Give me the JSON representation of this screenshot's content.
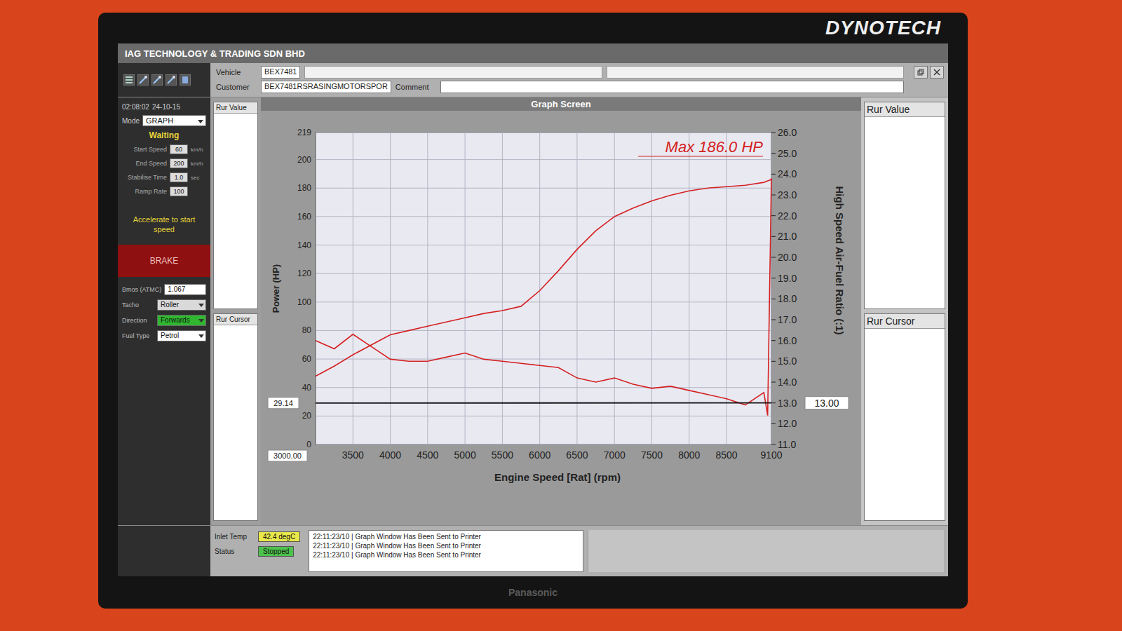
{
  "monitor": {
    "logo": "DYNOTECH",
    "brand": "Panasonic"
  },
  "window": {
    "title": "IAG TECHNOLOGY & TRADING SDN BHD"
  },
  "fields": [
    {
      "label": "Vehicle",
      "value": "BEX7481"
    },
    {
      "label": "Customer",
      "value": "BEX7481RSRASINGMOTORSPOR"
    },
    {
      "label": "Comment",
      "value": ""
    }
  ],
  "control": {
    "time": "02:08:02",
    "date": "24-10-15",
    "mode_label": "Mode",
    "mode": "GRAPH",
    "state": "Waiting",
    "settings": [
      {
        "label": "Start Speed",
        "value": "60",
        "unit": "km/h"
      },
      {
        "label": "End Speed",
        "value": "200",
        "unit": "km/h"
      },
      {
        "label": "Stabilise Time",
        "value": "1.0",
        "unit": "sec"
      },
      {
        "label": "Ramp Rate",
        "value": "100"
      }
    ],
    "prompt": "Accelerate to start speed",
    "brake": "BRAKE",
    "options": [
      {
        "label": "Bmos (ATMC)",
        "value": "1.067",
        "kind": "field",
        "color": "#ffffff"
      },
      {
        "label": "Tacho",
        "value": "Roller",
        "kind": "dropdown",
        "color": "#d9d9d9"
      },
      {
        "label": "Direction",
        "value": "Forwards",
        "kind": "dropdown",
        "color": "#2fb82f"
      },
      {
        "label": "Fuel Type",
        "value": "Petrol",
        "kind": "dropdown",
        "color": "#ffffff"
      }
    ]
  },
  "left_panels": [
    {
      "title": "Rur Value"
    },
    {
      "title": "Rur Cursor"
    }
  ],
  "right_panels": [
    {
      "title": "Rur Value"
    },
    {
      "title": "Rur Cursor"
    }
  ],
  "graph": {
    "header": "Graph Screen",
    "max_label": "Max 186.0 HP",
    "y_left": {
      "title": "Power (HP)",
      "ticks": [
        "0",
        "20",
        "40",
        "60",
        "80",
        "100",
        "120",
        "140",
        "160",
        "180",
        "200",
        "219"
      ]
    },
    "y_right": {
      "title": "High Speed Air-Fuel Ratio (:1)",
      "ticks": [
        "11.0",
        "12.0",
        "13.0",
        "14.0",
        "15.0",
        "16.0",
        "17.0",
        "18.0",
        "19.0",
        "20.0",
        "21.0",
        "22.0",
        "23.0",
        "24.0",
        "25.0",
        "26.0"
      ]
    },
    "x_axis": {
      "title": "Engine Speed [Rat] (rpm)",
      "start": "3000.00",
      "ticks": [
        "3500",
        "4000",
        "4500",
        "5000",
        "5500",
        "6000",
        "6500",
        "7000",
        "7500",
        "8000",
        "8500",
        "9100"
      ]
    },
    "rpm": [
      3000,
      3250,
      3500,
      3750,
      4000,
      4250,
      4500,
      4750,
      5000,
      5250,
      5500,
      5750,
      6000,
      6250,
      6500,
      6750,
      7000,
      7250,
      7500,
      7750,
      8000,
      8250,
      8500,
      8750,
      9000,
      9050,
      9100
    ],
    "power_hp": [
      48,
      55,
      63,
      70,
      77,
      80,
      83,
      86,
      89,
      92,
      94,
      97,
      108,
      122,
      137,
      150,
      160,
      166,
      171,
      175,
      178,
      180,
      181,
      182,
      184,
      185,
      186
    ],
    "afr": [
      16.0,
      15.6,
      16.3,
      15.7,
      15.1,
      15.0,
      15.0,
      15.2,
      15.4,
      15.1,
      15.0,
      14.9,
      14.8,
      14.7,
      14.2,
      14.0,
      14.2,
      13.9,
      13.7,
      13.8,
      13.6,
      13.4,
      13.2,
      12.9,
      13.5,
      12.4,
      23.8
    ],
    "cursor": {
      "left": "29.14",
      "right": "13.00"
    }
  },
  "status": {
    "inlet_label": "Inlet Temp",
    "inlet": "42.4 degC",
    "status_label": "Status",
    "status": "Stopped",
    "log": [
      "22:11:23/10 | Graph Window Has Been Sent to Printer",
      "22:11:23/10 | Graph Window Has Been Sent to Printer",
      "22:11:23/10 | Graph Window Has Been Sent to Printer"
    ]
  }
}
